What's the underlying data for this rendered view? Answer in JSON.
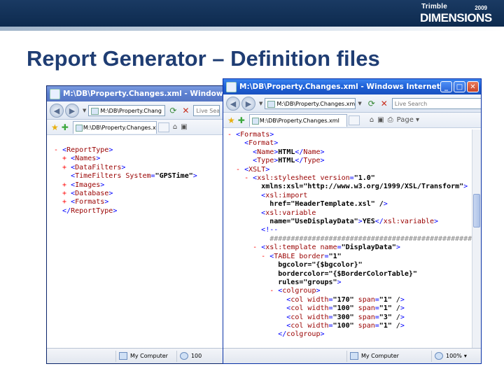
{
  "header": {
    "logo_brand": "Trimble",
    "logo_year": "2009",
    "logo_product": "DIMENSIONS",
    "slide_title": "Report Generator – Definition files"
  },
  "back_window": {
    "title": "M:\\DB\\Property.Changes.xml - Windows Inte...",
    "address": "M:\\DB\\Property.Chang",
    "search_placeholder": "Live Sea",
    "tab_label": "M:\\DB\\Property.Changes.xml",
    "status_computer": "My Computer",
    "status_zoom": "100",
    "xml": [
      {
        "indent": 0,
        "prefix": "- ",
        "text": "<ReportType>"
      },
      {
        "indent": 1,
        "prefix": "+ ",
        "text": "<Names>"
      },
      {
        "indent": 1,
        "prefix": "+ ",
        "text": "<DataFilters>"
      },
      {
        "indent": 1,
        "prefix": "  ",
        "text": "<TimeFilters System=\"GPSTime\">"
      },
      {
        "indent": 1,
        "prefix": "+ ",
        "text": "<Images>"
      },
      {
        "indent": 1,
        "prefix": "+ ",
        "text": "<Database>"
      },
      {
        "indent": 1,
        "prefix": "+ ",
        "text": "<Formats>"
      },
      {
        "indent": 0,
        "prefix": "  ",
        "text": "</ReportType>"
      }
    ]
  },
  "front_window": {
    "title": "M:\\DB\\Property.Changes.xml - Windows Internet Explorer",
    "address": "M:\\DB\\Property.Changes.xml",
    "search_placeholder": "Live Search",
    "tab_label": "M:\\DB\\Property.Changes.xml",
    "page_menu": "Page",
    "status_computer": "My Computer",
    "status_zoom": "100%",
    "xml_lines": [
      "- <Formats>",
      "    <Format>",
      "      <Name>HTML</Name>",
      "      <Type>HTML</Type>",
      "  - <XSLT>",
      "    - <xsl:stylesheet version=\"1.0\"",
      "        xmlns:xsl=\"http://www.w3.org/1999/XSL/Transform\">",
      "        <xsl:import",
      "          href=\"HeaderTemplate.xsl\" />",
      "        <xsl:variable",
      "          name=\"UseDisplayData\">YES</xsl:variable>",
      "        <!--",
      "          ######################################################",
      "      - <xsl:template name=\"DisplayData\">",
      "        - <TABLE border=\"1\"",
      "            bgcolor=\"{$bgcolor}\"",
      "            bordercolor=\"{$BorderColorTable}\"",
      "            rules=\"groups\">",
      "          - <colgroup>",
      "              <col width=\"170\" span=\"1\" />",
      "              <col width=\"100\" span=\"1\" />",
      "              <col width=\"300\" span=\"3\" />",
      "              <col width=\"100\" span=\"1\" />",
      "            </colgroup>"
    ]
  },
  "icons": {
    "back": "back-arrow-icon",
    "forward": "forward-arrow-icon",
    "refresh": "refresh-icon",
    "stop": "stop-icon",
    "favorites": "favorites-star-icon",
    "add_favorites": "add-favorites-icon",
    "home": "home-icon",
    "computer": "computer-icon"
  }
}
